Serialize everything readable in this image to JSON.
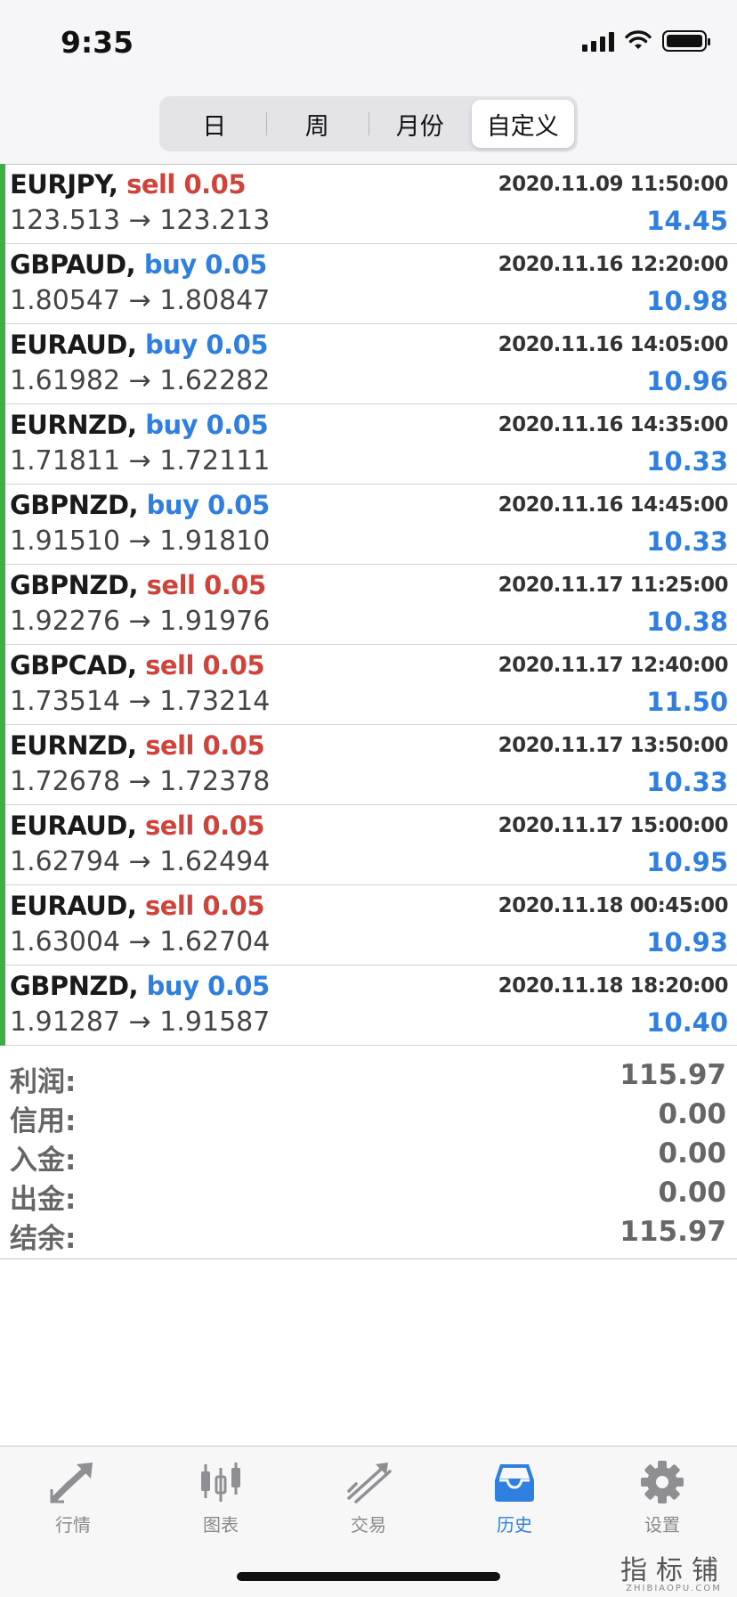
{
  "status_bar": {
    "time": "9:35"
  },
  "segment": {
    "items": [
      "日",
      "周",
      "月份",
      "自定义"
    ],
    "active": "自定义"
  },
  "trades": [
    {
      "symbol": "EURJPY,",
      "side": "sell 0.05",
      "type": "sell",
      "open": "123.513",
      "close": "123.213",
      "datetime": "2020.11.09 11:50:00",
      "profit": "14.45"
    },
    {
      "symbol": "GBPAUD,",
      "side": "buy 0.05",
      "type": "buy",
      "open": "1.80547",
      "close": "1.80847",
      "datetime": "2020.11.16 12:20:00",
      "profit": "10.98"
    },
    {
      "symbol": "EURAUD,",
      "side": "buy 0.05",
      "type": "buy",
      "open": "1.61982",
      "close": "1.62282",
      "datetime": "2020.11.16 14:05:00",
      "profit": "10.96"
    },
    {
      "symbol": "EURNZD,",
      "side": "buy 0.05",
      "type": "buy",
      "open": "1.71811",
      "close": "1.72111",
      "datetime": "2020.11.16 14:35:00",
      "profit": "10.33"
    },
    {
      "symbol": "GBPNZD,",
      "side": "buy 0.05",
      "type": "buy",
      "open": "1.91510",
      "close": "1.91810",
      "datetime": "2020.11.16 14:45:00",
      "profit": "10.33"
    },
    {
      "symbol": "GBPNZD,",
      "side": "sell 0.05",
      "type": "sell",
      "open": "1.92276",
      "close": "1.91976",
      "datetime": "2020.11.17 11:25:00",
      "profit": "10.38"
    },
    {
      "symbol": "GBPCAD,",
      "side": "sell 0.05",
      "type": "sell",
      "open": "1.73514",
      "close": "1.73214",
      "datetime": "2020.11.17 12:40:00",
      "profit": "11.50"
    },
    {
      "symbol": "EURNZD,",
      "side": "sell 0.05",
      "type": "sell",
      "open": "1.72678",
      "close": "1.72378",
      "datetime": "2020.11.17 13:50:00",
      "profit": "10.33"
    },
    {
      "symbol": "EURAUD,",
      "side": "sell 0.05",
      "type": "sell",
      "open": "1.62794",
      "close": "1.62494",
      "datetime": "2020.11.17 15:00:00",
      "profit": "10.95"
    },
    {
      "symbol": "EURAUD,",
      "side": "sell 0.05",
      "type": "sell",
      "open": "1.63004",
      "close": "1.62704",
      "datetime": "2020.11.18 00:45:00",
      "profit": "10.93"
    },
    {
      "symbol": "GBPNZD,",
      "side": "buy 0.05",
      "type": "buy",
      "open": "1.91287",
      "close": "1.91587",
      "datetime": "2020.11.18 18:20:00",
      "profit": "10.40"
    }
  ],
  "arrow": "→",
  "summary": [
    {
      "label": "利润:",
      "value": "115.97"
    },
    {
      "label": "信用:",
      "value": "0.00"
    },
    {
      "label": "入金:",
      "value": "0.00"
    },
    {
      "label": "出金:",
      "value": "0.00"
    },
    {
      "label": "结余:",
      "value": "115.97"
    }
  ],
  "tabbar": [
    {
      "label": "行情",
      "icon": "quotes-icon"
    },
    {
      "label": "图表",
      "icon": "chart-icon"
    },
    {
      "label": "交易",
      "icon": "trade-icon"
    },
    {
      "label": "历史",
      "icon": "history-icon"
    },
    {
      "label": "设置",
      "icon": "settings-icon"
    }
  ],
  "tabbar_active": "历史",
  "watermark": {
    "text": "指标铺",
    "sub": "ZHIBIAOPU.COM"
  },
  "colors": {
    "sell": "#d0433b",
    "buy": "#2f7fe0",
    "profit": "#2f7fe0",
    "row_marker": "#3cb043",
    "active_tab": "#2f7fe0"
  }
}
